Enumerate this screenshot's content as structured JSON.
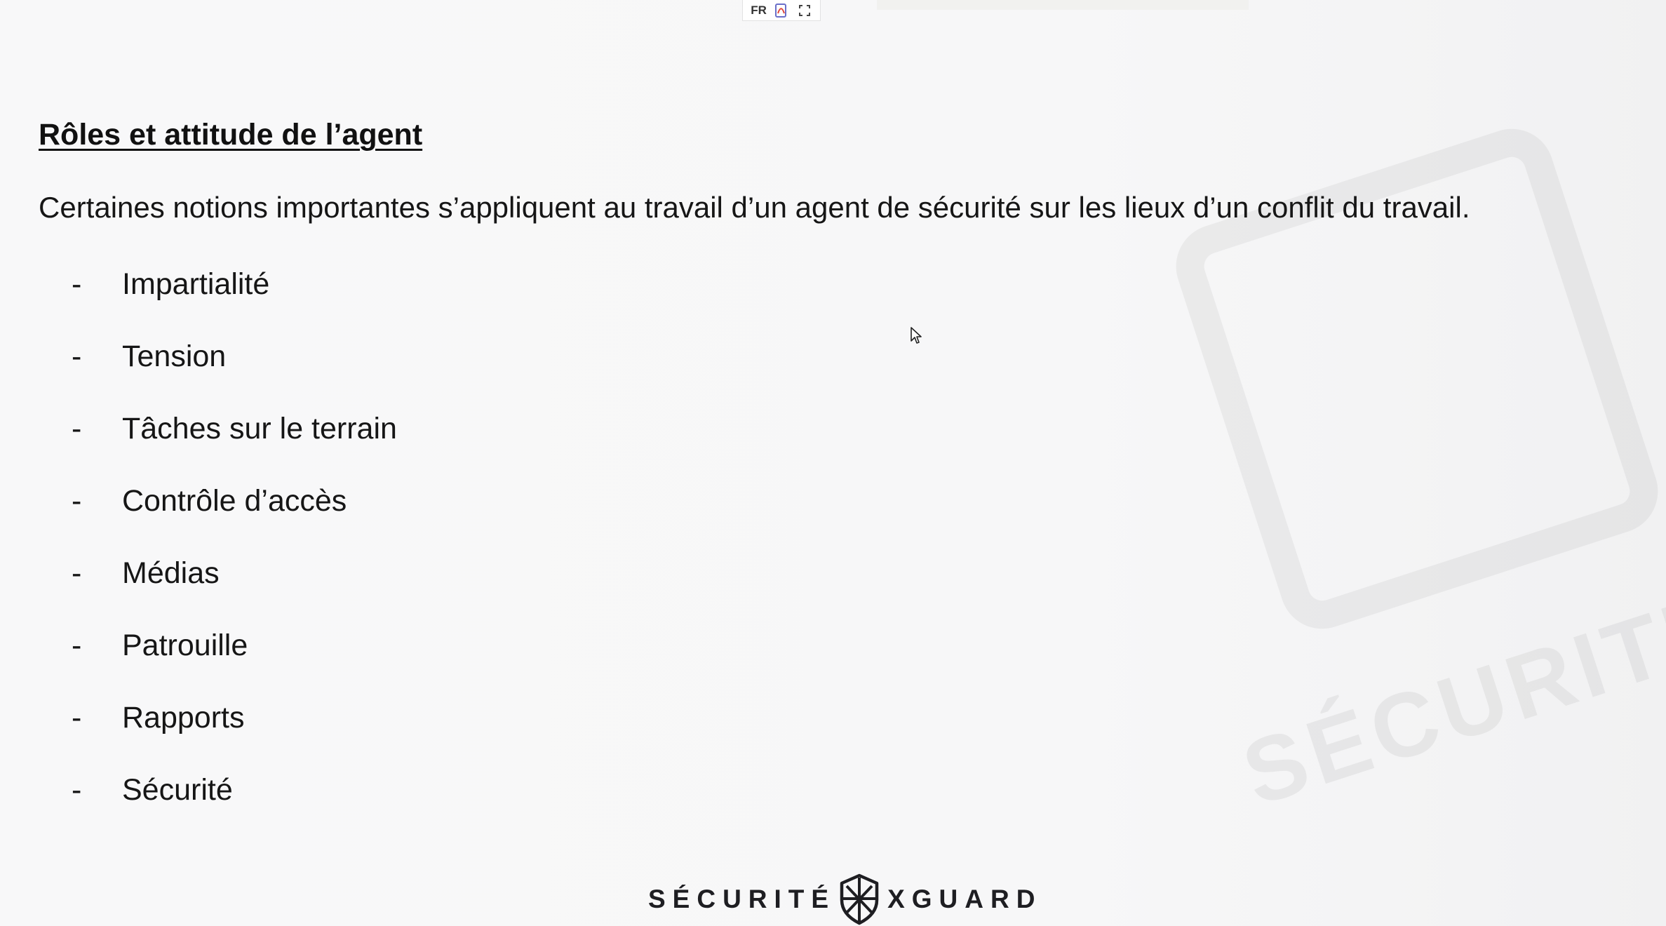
{
  "toolbar": {
    "language": "FR",
    "icons": [
      "pdf-icon",
      "fullscreen-icon"
    ]
  },
  "slide": {
    "title": "Rôles et attitude de l’agent",
    "intro": "Certaines notions importantes s’appliquent au travail d’un agent de sécurité sur les lieux d’un conflit du travail.",
    "bullet": "-",
    "items": [
      "Impartialité",
      "Tension",
      "Tâches sur le terrain",
      "Contrôle d’accès",
      "Médias",
      "Patrouille",
      "Rapports",
      "Sécurité"
    ]
  },
  "footer": {
    "logo_left": "SÉCURITÉ",
    "logo_right": "XGUARD"
  },
  "watermark": {
    "text": "SÉCURITÉ"
  },
  "colors": {
    "background": "#f7f7f8",
    "text": "#111111",
    "logo": "#1e1e22"
  }
}
